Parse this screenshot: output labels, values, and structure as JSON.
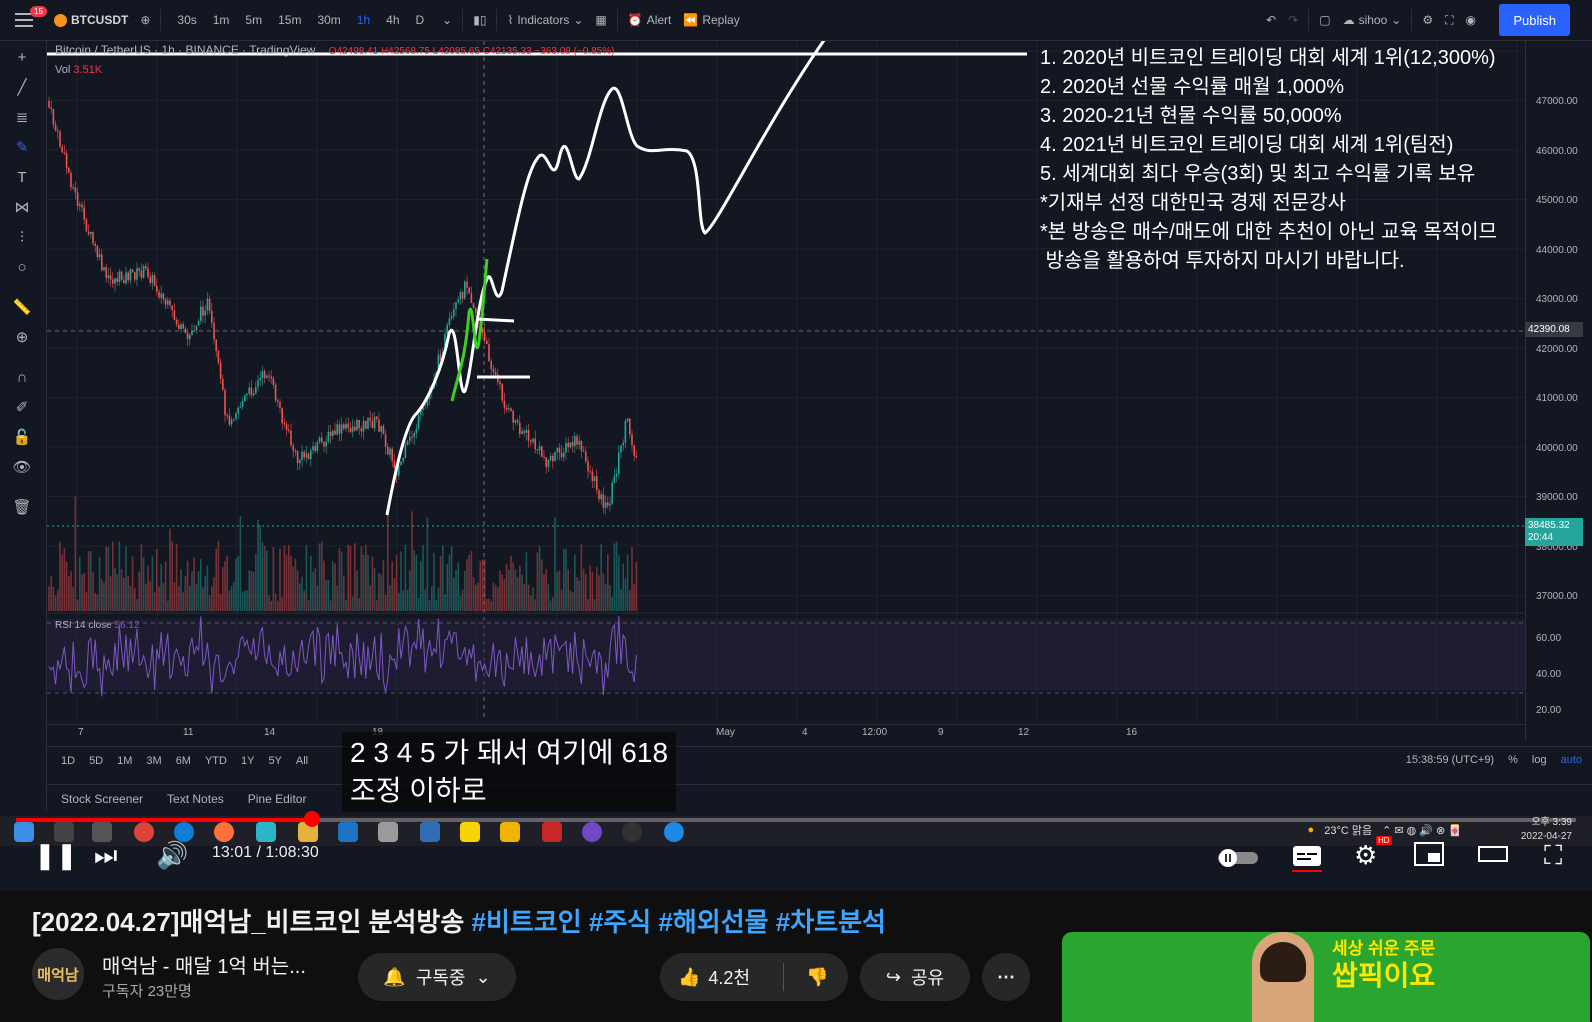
{
  "tradingview": {
    "notification_count": "15",
    "symbol": "BTCUSDT",
    "timeframes": [
      "30s",
      "1m",
      "5m",
      "15m",
      "30m",
      "1h",
      "4h",
      "D"
    ],
    "active_timeframe": "1h",
    "indicators_label": "Indicators",
    "alert_label": "Alert",
    "replay_label": "Replay",
    "user": "sihoo",
    "publish_label": "Publish",
    "legend_title": "Bitcoin / TetherUS · 1h · BINANCE · TradingView",
    "legend_ohlc": "O42498.41 H42568.75 L42085.65 C42135.33 −363.08 (−0.85%)",
    "vol_label": "Vol",
    "vol_value": "3.51K",
    "rsi_label": "RSI 14 close",
    "rsi_value": "56.12",
    "y_ticks": [
      "47000.00",
      "46000.00",
      "45000.00",
      "44000.00",
      "43000.00",
      "42000.00",
      "41000.00",
      "40000.00",
      "39000.00",
      "38000.00",
      "37000.00"
    ],
    "rsi_ticks": [
      "60.00",
      "40.00",
      "20.00"
    ],
    "current_price": "42390.08",
    "last_price": "38485.32",
    "last_price_timer": "20:44",
    "x_ticks": [
      "7",
      "11",
      "14",
      "18",
      "May",
      "4",
      "12:00",
      "9",
      "12",
      "16"
    ],
    "ranges": [
      "1D",
      "5D",
      "1M",
      "3M",
      "6M",
      "YTD",
      "1Y",
      "5Y",
      "All"
    ],
    "clock": "15:38:59 (UTC+9)",
    "percent_label": "%",
    "log_label": "log",
    "auto_label": "auto",
    "bottom_tabs": [
      "Stock Screener",
      "Text Notes",
      "Pine Editor"
    ]
  },
  "overlay_lines": [
    "1. 2020년 비트코인 트레이딩 대회 세계 1위(12,300%)",
    "2. 2020년 선물 수익률 매월 1,000%",
    "3. 2020-21년 현물 수익률 50,000%",
    "4. 2021년 비트코인 트레이딩 대회 세계 1위(팀전)",
    "5. 세계대회 최다 우승(3회) 및 최고 수익률 기록 보유",
    "*기재부 선정 대한민국 경제 전문강사",
    "*본 방송은 매수/매도에 대한 추천이 아닌 교육 목적이므",
    " 방송을 활용하여 투자하지 마시기 바랍니다."
  ],
  "caption": {
    "line1": "2 3 4 5 가 돼서 여기에 618",
    "line2": "조정 이하로"
  },
  "taskbar": {
    "weather": "23°C 맑음",
    "time": "오후 3:39",
    "date": "2022-04-27"
  },
  "player": {
    "time": "13:01 / 1:08:30",
    "progress": 0.19,
    "hd_badge": "HD"
  },
  "video": {
    "title_prefix": "[2022.04.27]매억남_비트코인 분석방송 ",
    "tags": [
      "#비트코인",
      "#주식",
      "#해외선물",
      "#차트분석"
    ],
    "channel_avatar": "매억남",
    "channel_name": "매억남 - 매달 1억 버는...",
    "subscribers": "구독자 23만명",
    "subscribe_label": "구독중",
    "like_count": "4.2천",
    "share_label": "공유",
    "more_label": "⋯"
  },
  "ad": {
    "line1": "세상 쉬운 주문",
    "line2": "쌉픽이요"
  },
  "colors": {
    "up": "#26a69a",
    "down": "#ef5350",
    "accent": "#2962ff",
    "youtube_red": "#ff0000",
    "link": "#3ea6ff",
    "ad_green": "#2aa52f"
  }
}
